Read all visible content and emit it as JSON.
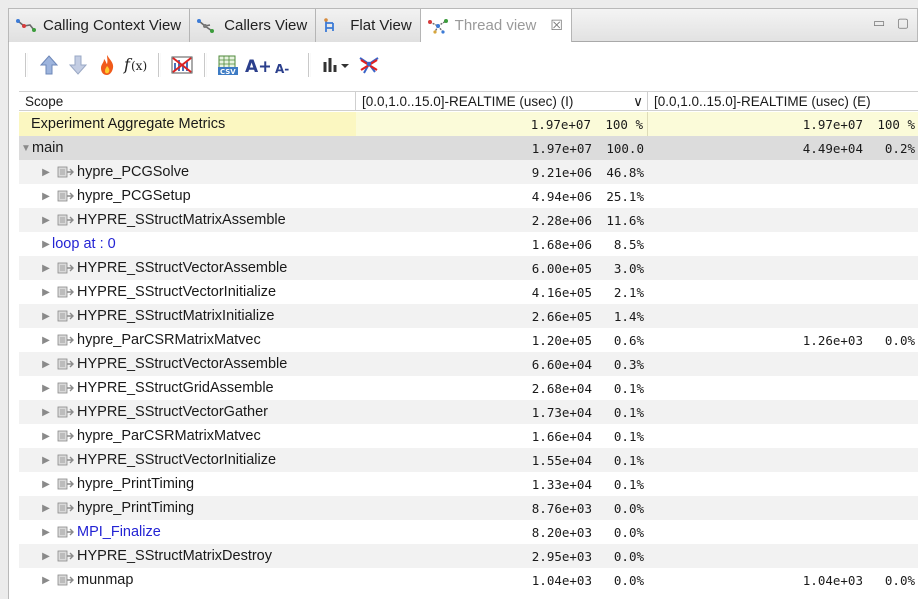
{
  "tabs": [
    {
      "label": "Calling Context View",
      "active": false,
      "icon": "calling-context-icon"
    },
    {
      "label": "Callers View",
      "active": false,
      "icon": "callers-icon"
    },
    {
      "label": "Flat View",
      "active": false,
      "icon": "flat-view-icon"
    },
    {
      "label": "Thread view",
      "active": true,
      "icon": "thread-view-icon",
      "close": "☒"
    }
  ],
  "window_controls": "▭ ▢",
  "toolbar": {
    "buttons": [
      "up-arrow-icon",
      "down-arrow-icon",
      "hot-path-flame-icon",
      "derived-metric-fx-icon",
      "filter-metrics-icon",
      "csv-export-icon",
      "font-increase-icon",
      "font-decrease-icon",
      "graph-bars-icon",
      "thread-select-icon"
    ],
    "font_increase_label": "A+",
    "font_decrease_label": "A-"
  },
  "table": {
    "columns": [
      {
        "label": "Scope"
      },
      {
        "label": "[0.0,1.0..15.0]-REALTIME (usec) (I)",
        "sort": "∨"
      },
      {
        "label": "[0.0,1.0..15.0]-REALTIME (usec) (E)"
      }
    ],
    "rows": [
      {
        "type": "aggregate",
        "scope": "Experiment Aggregate Metrics",
        "i_val": "1.97e+07",
        "i_pct": "100 %",
        "e_val": "1.97e+07",
        "e_pct": "100 %"
      },
      {
        "type": "main",
        "scope": "main",
        "i_val": "1.97e+07",
        "i_pct": "100.0",
        "e_val": "4.49e+04",
        "e_pct": "0.2%"
      },
      {
        "type": "call",
        "scope": "hypre_PCGSolve",
        "i_val": "9.21e+06",
        "i_pct": "46.8%",
        "e_val": "",
        "e_pct": ""
      },
      {
        "type": "call",
        "scope": "hypre_PCGSetup",
        "i_val": "4.94e+06",
        "i_pct": "25.1%",
        "e_val": "",
        "e_pct": ""
      },
      {
        "type": "call",
        "scope": "HYPRE_SStructMatrixAssemble",
        "i_val": "2.28e+06",
        "i_pct": "11.6%",
        "e_val": "",
        "e_pct": ""
      },
      {
        "type": "loop",
        "scope": "loop at : 0",
        "i_val": "1.68e+06",
        "i_pct": "8.5%",
        "e_val": "",
        "e_pct": ""
      },
      {
        "type": "call",
        "scope": "HYPRE_SStructVectorAssemble",
        "i_val": "6.00e+05",
        "i_pct": "3.0%",
        "e_val": "",
        "e_pct": ""
      },
      {
        "type": "call",
        "scope": "HYPRE_SStructVectorInitialize",
        "i_val": "4.16e+05",
        "i_pct": "2.1%",
        "e_val": "",
        "e_pct": ""
      },
      {
        "type": "call",
        "scope": "HYPRE_SStructMatrixInitialize",
        "i_val": "2.66e+05",
        "i_pct": "1.4%",
        "e_val": "",
        "e_pct": ""
      },
      {
        "type": "call",
        "scope": "hypre_ParCSRMatrixMatvec",
        "i_val": "1.20e+05",
        "i_pct": "0.6%",
        "e_val": "1.26e+03",
        "e_pct": "0.0%"
      },
      {
        "type": "call",
        "scope": "HYPRE_SStructVectorAssemble",
        "i_val": "6.60e+04",
        "i_pct": "0.3%",
        "e_val": "",
        "e_pct": ""
      },
      {
        "type": "call",
        "scope": "HYPRE_SStructGridAssemble",
        "i_val": "2.68e+04",
        "i_pct": "0.1%",
        "e_val": "",
        "e_pct": ""
      },
      {
        "type": "call",
        "scope": "HYPRE_SStructVectorGather",
        "i_val": "1.73e+04",
        "i_pct": "0.1%",
        "e_val": "",
        "e_pct": ""
      },
      {
        "type": "call",
        "scope": "hypre_ParCSRMatrixMatvec",
        "i_val": "1.66e+04",
        "i_pct": "0.1%",
        "e_val": "",
        "e_pct": ""
      },
      {
        "type": "call",
        "scope": "HYPRE_SStructVectorInitialize",
        "i_val": "1.55e+04",
        "i_pct": "0.1%",
        "e_val": "",
        "e_pct": ""
      },
      {
        "type": "call",
        "scope": "hypre_PrintTiming",
        "i_val": "1.33e+04",
        "i_pct": "0.1%",
        "e_val": "",
        "e_pct": ""
      },
      {
        "type": "call",
        "scope": "hypre_PrintTiming",
        "i_val": "8.76e+03",
        "i_pct": "0.0%",
        "e_val": "",
        "e_pct": ""
      },
      {
        "type": "call-link",
        "scope": "MPI_Finalize",
        "i_val": "8.20e+03",
        "i_pct": "0.0%",
        "e_val": "",
        "e_pct": ""
      },
      {
        "type": "call",
        "scope": "HYPRE_SStructMatrixDestroy",
        "i_val": "2.95e+03",
        "i_pct": "0.0%",
        "e_val": "",
        "e_pct": ""
      },
      {
        "type": "call",
        "scope": "munmap",
        "i_val": "1.04e+03",
        "i_pct": "0.0%",
        "e_val": "1.04e+03",
        "e_pct": "0.0%"
      }
    ]
  },
  "colors": {
    "aggregate_bg": "#fbf7c1",
    "selected_bg": "#dcdcdc",
    "link_text": "#2323d4",
    "tab_active_text": "#9a9a9a"
  },
  "expander_glyphs": {
    "collapsed": "▶",
    "expanded": "▼"
  }
}
